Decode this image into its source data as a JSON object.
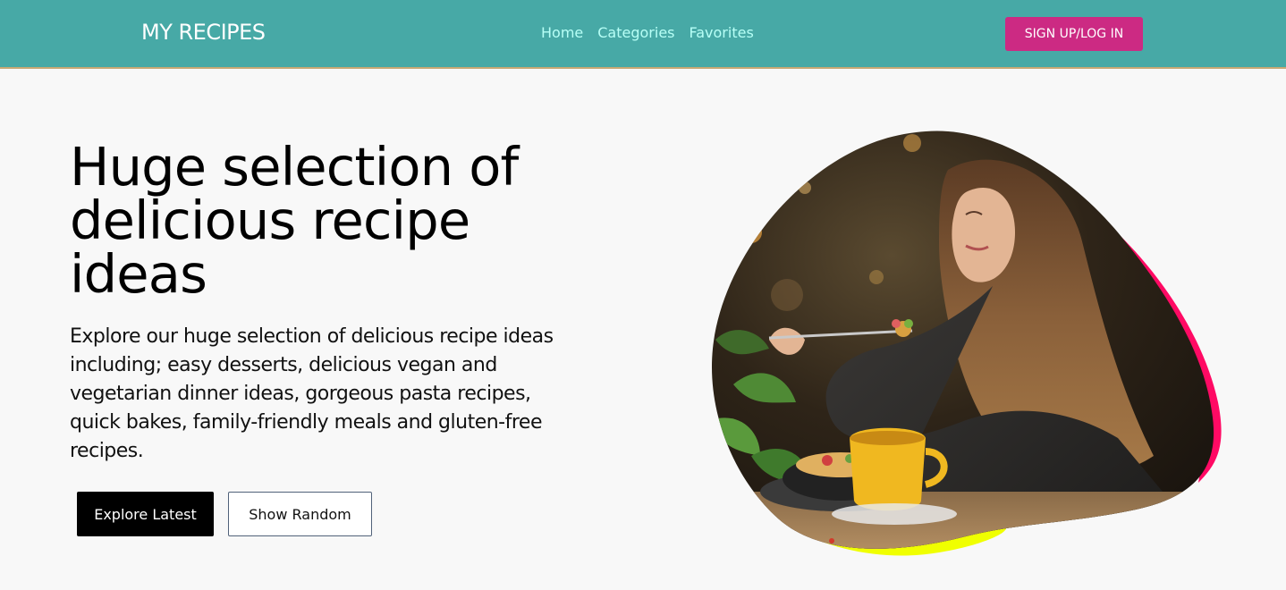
{
  "header": {
    "brand": "MY RECIPES",
    "nav": [
      {
        "label": "Home"
      },
      {
        "label": "Categories"
      },
      {
        "label": "Favorites"
      }
    ],
    "signup_label": "SIGN UP/LOG IN"
  },
  "hero": {
    "title": "Huge selection of delicious recipe ideas",
    "description": "Explore our huge selection of delicious recipe ideas including; easy desserts, delicious vegan and vegetarian dinner ideas, gorgeous pasta recipes, quick bakes, family-friendly meals and gluten-free recipes.",
    "buttons": {
      "explore_label": "Explore Latest",
      "random_label": "Show Random"
    }
  },
  "colors": {
    "header_bg": "#47a9a6",
    "nav_link": "#b7fff6",
    "signup_bg": "#cc2a83",
    "blob_accent_pink": "#ff0a64",
    "blob_accent_yellow": "#f0ff00"
  }
}
